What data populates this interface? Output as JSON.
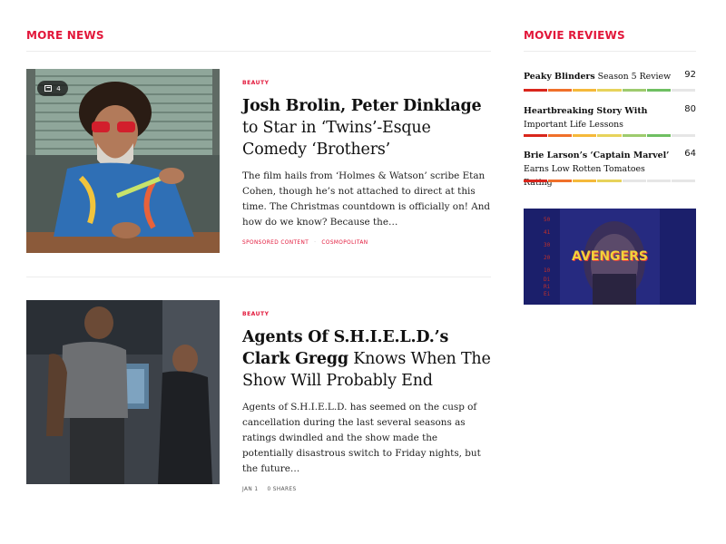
{
  "sections": {
    "more_news": "MORE NEWS",
    "movie_reviews": "MOVIE REVIEWS"
  },
  "articles": [
    {
      "category": "BEAUTY",
      "headline_bold": "Josh Brolin, Peter Dinklage",
      "headline_rest": " to Star in ‘Twins’-Esque Comedy ‘Brothers’",
      "excerpt": "The film hails from ‘Holmes & Watson’ scribe Etan Cohen, though he’s not attached to direct at this time. The Christmas countdown is officially on! And how do we know? Because the…",
      "meta_1": "SPONSORED CONTENT",
      "meta_2": "COSMOPOLITAN",
      "gallery_count": "4"
    },
    {
      "category": "BEAUTY",
      "headline_bold": "Agents Of S.H.I.E.L.D.’s Clark Gregg",
      "headline_rest": " Knows When The Show Will Probably End",
      "excerpt": "Agents of S.H.I.E.L.D. has seemed on the cusp of cancellation during the last several seasons as ratings dwindled and the show made the potentially disastrous switch to Friday nights, but the future…",
      "meta_1": "JAN 1",
      "meta_2": "0 SHARES"
    }
  ],
  "reviews": [
    {
      "title_bold": "Peaky Blinders",
      "title_rest": " Season 5 Review",
      "score": "92",
      "rating": 92
    },
    {
      "title_bold": "Heartbreaking Story With",
      "title_rest": " Important Life Lessons",
      "score": "80",
      "rating": 80
    },
    {
      "title_bold": "Brie Larson’s ‘Captain Marvel’",
      "title_rest": " Earns Low Rotten Tomatoes Rating",
      "score": "64",
      "rating": 64
    }
  ],
  "ad": {
    "logo_text": "AVENGERS",
    "numbers": [
      "50",
      "41",
      "30",
      "20",
      "10",
      "Di",
      "Ri",
      "Ei"
    ]
  },
  "colors": {
    "accent": "#e2173a",
    "bar_segments": [
      "#d9261c",
      "#f0702a",
      "#f5b93a",
      "#e7d35b",
      "#9ecb6e",
      "#6fbf62",
      "#47b04a"
    ]
  }
}
